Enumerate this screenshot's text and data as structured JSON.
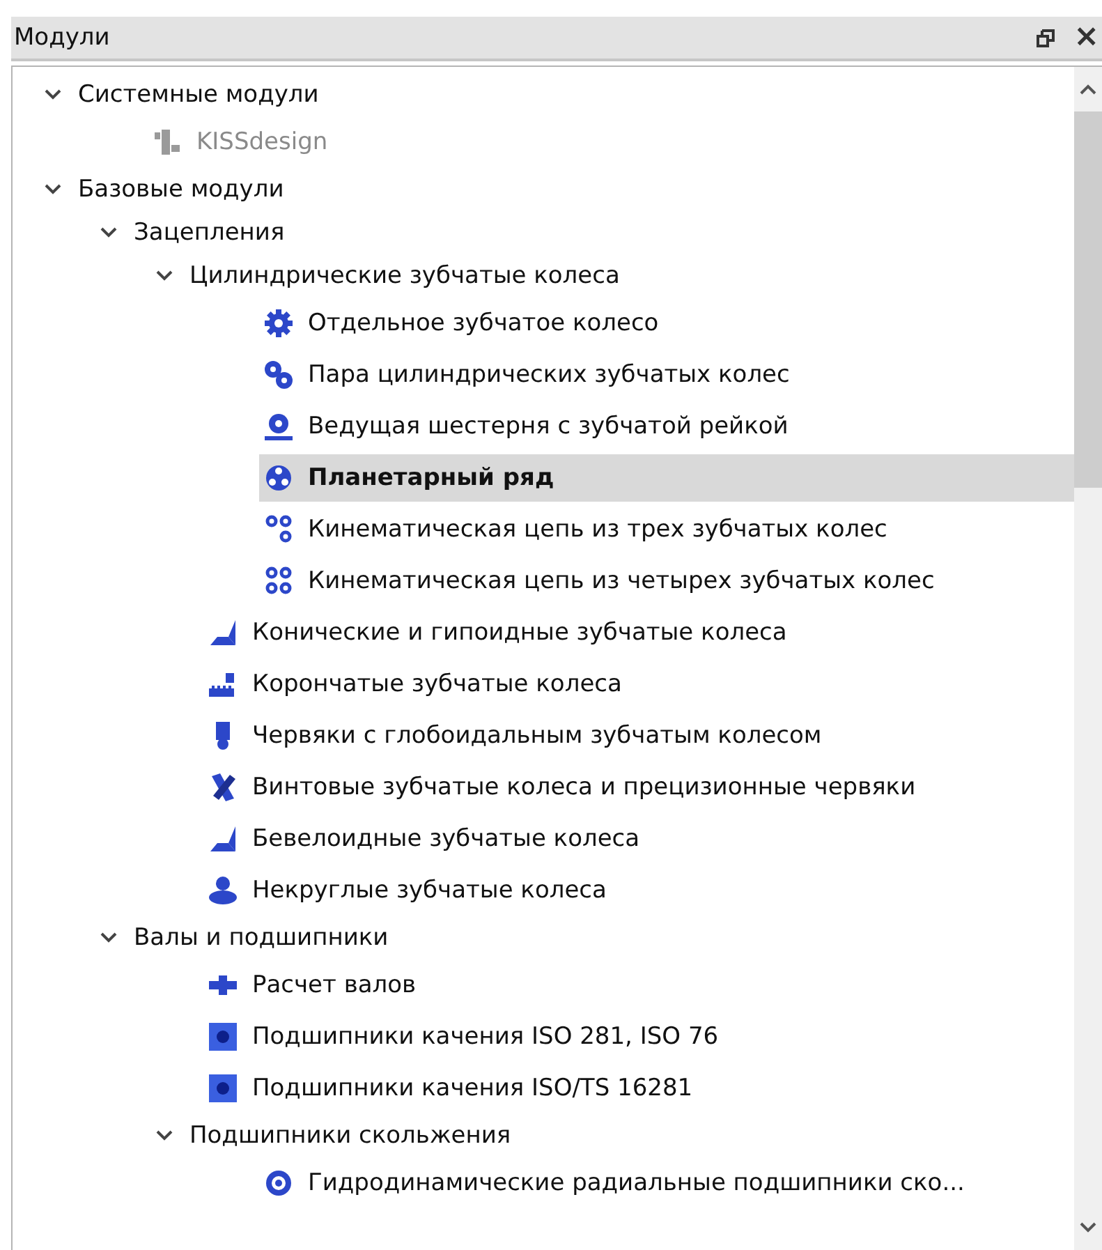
{
  "panel": {
    "title": "Модули",
    "close_label": "×"
  },
  "tree": [
    {
      "kind": "group",
      "label": "Системные модули",
      "expanded": true,
      "selected": false,
      "disabled": false,
      "children": [
        {
          "kind": "kissdesign",
          "label": "KISSdesign",
          "selected": false,
          "disabled": true
        }
      ]
    },
    {
      "kind": "group",
      "label": "Базовые модули",
      "expanded": true,
      "selected": false,
      "disabled": false,
      "children": [
        {
          "kind": "group",
          "label": "Зацепления",
          "expanded": true,
          "selected": false,
          "disabled": false,
          "children": [
            {
              "kind": "group",
              "label": "Цилиндрические зубчатые колеса",
              "expanded": true,
              "selected": false,
              "disabled": false,
              "children": [
                {
                  "kind": "gear",
                  "label": "Отдельное зубчатое колесо",
                  "selected": false,
                  "disabled": false
                },
                {
                  "kind": "gear-pair",
                  "label": "Пара цилиндрических зубчатых колес",
                  "selected": false,
                  "disabled": false
                },
                {
                  "kind": "gear-rack",
                  "label": "Ведущая шестерня с зубчатой рейкой",
                  "selected": false,
                  "disabled": false
                },
                {
                  "kind": "planetary",
                  "label": "Планетарный ряд",
                  "selected": true,
                  "disabled": false
                },
                {
                  "kind": "chain3",
                  "label": "Кинематическая цепь из трех зубчатых колес",
                  "selected": false,
                  "disabled": false
                },
                {
                  "kind": "chain4",
                  "label": "Кинематическая цепь из четырех зубчатых колес",
                  "selected": false,
                  "disabled": false
                }
              ]
            },
            {
              "kind": "bevel",
              "label": "Конические и гипоидные зубчатые колеса",
              "selected": false,
              "disabled": false
            },
            {
              "kind": "crown",
              "label": "Корончатые зубчатые колеса",
              "selected": false,
              "disabled": false
            },
            {
              "kind": "worm",
              "label": "Червяки с глобоидальным зубчатым колесом",
              "selected": false,
              "disabled": false
            },
            {
              "kind": "crossed",
              "label": "Винтовые зубчатые колеса и прецизионные червяки",
              "selected": false,
              "disabled": false
            },
            {
              "kind": "beveloid",
              "label": "Бевелоидные зубчатые колеса",
              "selected": false,
              "disabled": false
            },
            {
              "kind": "noncircular",
              "label": "Некруглые зубчатые колеса",
              "selected": false,
              "disabled": false
            }
          ]
        },
        {
          "kind": "group",
          "label": "Валы и подшипники",
          "expanded": true,
          "selected": false,
          "disabled": false,
          "children": [
            {
              "kind": "shaft",
              "label": "Расчет валов",
              "selected": false,
              "disabled": false
            },
            {
              "kind": "bearing",
              "label": "Подшипники качения ISO 281, ISO 76",
              "selected": false,
              "disabled": false
            },
            {
              "kind": "bearing",
              "label": "Подшипники качения ISO/TS 16281",
              "selected": false,
              "disabled": false
            },
            {
              "kind": "group",
              "label": "Подшипники скольжения",
              "expanded": true,
              "selected": false,
              "disabled": false,
              "children": [
                {
                  "kind": "plain-bearing",
                  "label": "Гидродинамические радиальные подшипники ско...",
                  "selected": false,
                  "disabled": false
                }
              ]
            }
          ]
        }
      ]
    }
  ]
}
